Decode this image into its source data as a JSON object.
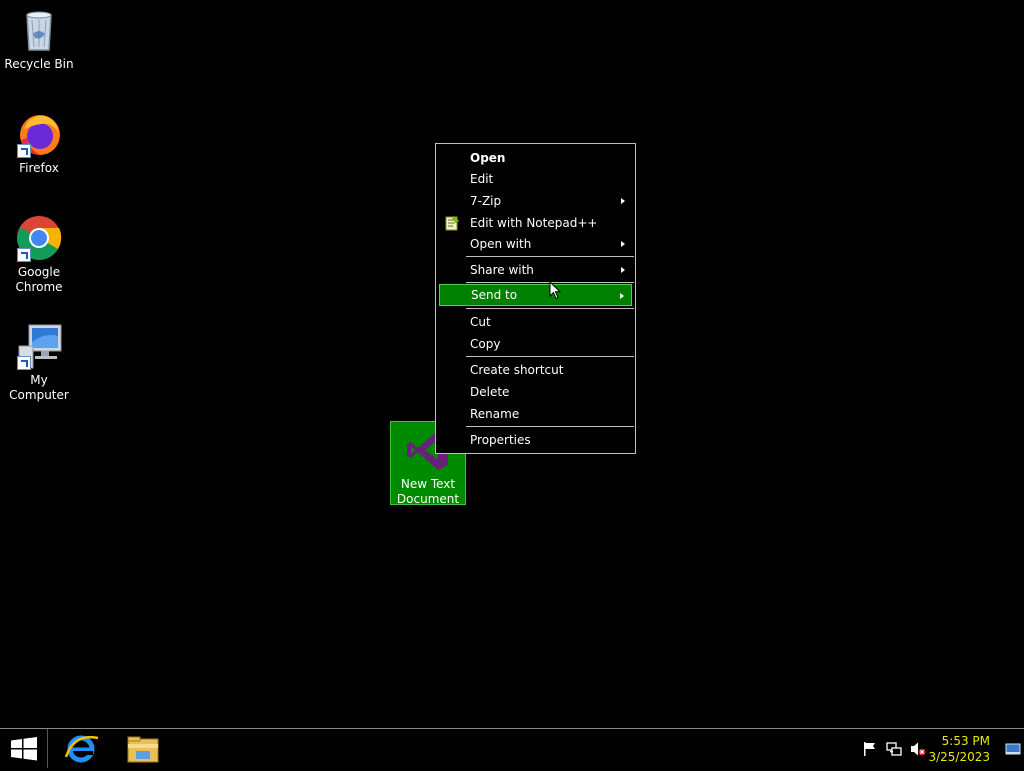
{
  "desktop": {
    "icons": [
      {
        "label": "Recycle Bin"
      },
      {
        "label": "Firefox"
      },
      {
        "label": "Google Chrome"
      },
      {
        "label": "My Computer"
      }
    ],
    "selected_file": {
      "label": "New Text Document",
      "icon": "visual-studio-icon"
    }
  },
  "context_menu": {
    "items": [
      {
        "label": "Open",
        "bold": true
      },
      {
        "label": "Edit"
      },
      {
        "label": "7-Zip",
        "submenu": true
      },
      {
        "label": "Edit with Notepad++",
        "icon": "notepad-plus-plus-icon"
      },
      {
        "label": "Open with",
        "submenu": true
      },
      {
        "label": "Share with",
        "submenu": true
      },
      {
        "label": "Send to",
        "submenu": true,
        "highlighted": true
      },
      {
        "label": "Cut"
      },
      {
        "label": "Copy"
      },
      {
        "label": "Create shortcut"
      },
      {
        "label": "Delete"
      },
      {
        "label": "Rename"
      },
      {
        "label": "Properties"
      }
    ]
  },
  "taskbar": {
    "pinned": [
      {
        "name": "internet-explorer-icon"
      },
      {
        "name": "file-explorer-icon"
      }
    ],
    "tray": [
      "flag-icon",
      "network-icon",
      "volume-muted-icon"
    ],
    "clock": {
      "time": "5:53 PM",
      "date": "3/25/2023"
    }
  },
  "colors": {
    "highlight": "#008000",
    "clock_text": "#e8e800",
    "desktop_background": "#000000"
  }
}
